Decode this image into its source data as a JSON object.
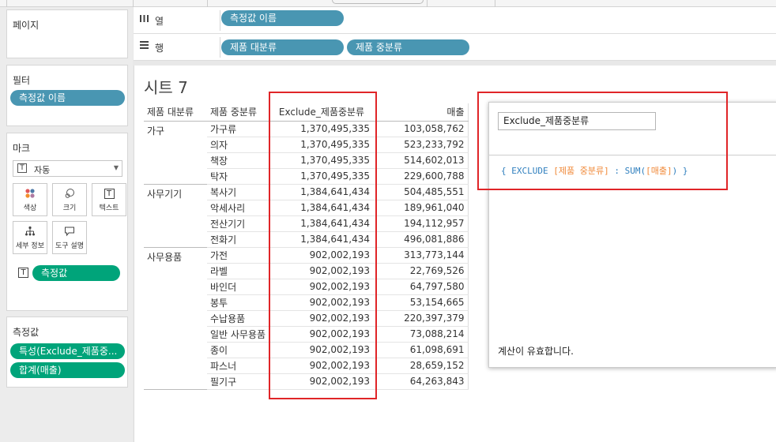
{
  "left_panel": {
    "pages": {
      "title": "페이지"
    },
    "filters": {
      "title": "필터",
      "pills": [
        "측정값 이름"
      ]
    },
    "marks": {
      "title": "마크",
      "mark_type": "자동",
      "buttons": [
        {
          "label": "색상",
          "icon": "color-icon"
        },
        {
          "label": "크기",
          "icon": "size-icon"
        },
        {
          "label": "텍스트",
          "icon": "text-icon"
        },
        {
          "label": "세부 정보",
          "icon": "detail-icon"
        },
        {
          "label": "도구 설명",
          "icon": "tooltip-icon"
        }
      ],
      "text_pill": "측정값"
    },
    "measure_values": {
      "title": "측정값",
      "pills": [
        "특성(Exclude_제품중...",
        "합계(매출)"
      ]
    }
  },
  "shelves": {
    "columns": {
      "label": "열",
      "pills": [
        "측정값 이름"
      ]
    },
    "rows": {
      "label": "행",
      "pills": [
        "제품 대분류",
        "제품 중분류"
      ]
    }
  },
  "sheet": {
    "title": "시트 7",
    "headers": [
      "제품 대분류",
      "제품 중분류",
      "Exclude_제품중분류",
      "매출"
    ],
    "groups": [
      {
        "category": "가구",
        "rows": [
          {
            "sub": "가구류",
            "exclude": "1,370,495,335",
            "sales": "103,058,762"
          },
          {
            "sub": "의자",
            "exclude": "1,370,495,335",
            "sales": "523,233,792"
          },
          {
            "sub": "책장",
            "exclude": "1,370,495,335",
            "sales": "514,602,013"
          },
          {
            "sub": "탁자",
            "exclude": "1,370,495,335",
            "sales": "229,600,788"
          }
        ]
      },
      {
        "category": "사무기기",
        "rows": [
          {
            "sub": "복사기",
            "exclude": "1,384,641,434",
            "sales": "504,485,551"
          },
          {
            "sub": "악세사리",
            "exclude": "1,384,641,434",
            "sales": "189,961,040"
          },
          {
            "sub": "전산기기",
            "exclude": "1,384,641,434",
            "sales": "194,112,957"
          },
          {
            "sub": "전화기",
            "exclude": "1,384,641,434",
            "sales": "496,081,886"
          }
        ]
      },
      {
        "category": "사무용품",
        "rows": [
          {
            "sub": "가전",
            "exclude": "902,002,193",
            "sales": "313,773,144"
          },
          {
            "sub": "라벨",
            "exclude": "902,002,193",
            "sales": "22,769,526"
          },
          {
            "sub": "바인더",
            "exclude": "902,002,193",
            "sales": "64,797,580"
          },
          {
            "sub": "봉투",
            "exclude": "902,002,193",
            "sales": "53,154,665"
          },
          {
            "sub": "수납용품",
            "exclude": "902,002,193",
            "sales": "220,397,379"
          },
          {
            "sub": "일반 사무용품",
            "exclude": "902,002,193",
            "sales": "73,088,214"
          },
          {
            "sub": "종이",
            "exclude": "902,002,193",
            "sales": "61,098,691"
          },
          {
            "sub": "파스너",
            "exclude": "902,002,193",
            "sales": "28,659,152"
          },
          {
            "sub": "필기구",
            "exclude": "902,002,193",
            "sales": "64,263,843"
          }
        ]
      }
    ]
  },
  "calc": {
    "name": "Exclude_제품중분류",
    "formula": {
      "open": "{ ",
      "keyword": "EXCLUDE",
      "field1": "[제품 중분류]",
      "colon": " : ",
      "func": "SUM(",
      "field2": "[매출]",
      "close": ") }"
    },
    "status": "계산이 유효합니다."
  },
  "colors": {
    "pill_blue": "#4996b2",
    "pill_green": "#00a47a",
    "highlight_red": "#e02528",
    "formula_keyword": "#2f7fbe",
    "formula_field": "#f08a3a"
  }
}
